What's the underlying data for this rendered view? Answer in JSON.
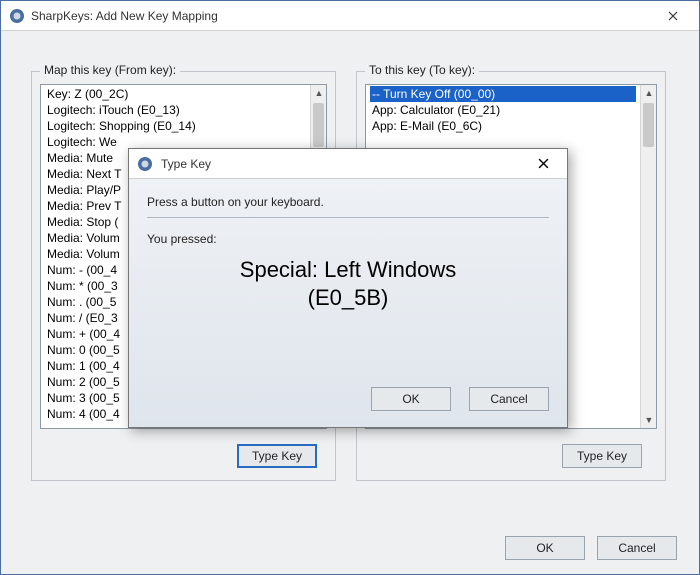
{
  "window": {
    "title": "SharpKeys: Add New Key Mapping"
  },
  "from": {
    "label": "Map this key (From key):",
    "type_key_button": "Type Key",
    "items": [
      "Key: Z (00_2C)",
      "Logitech: iTouch (E0_13)",
      "Logitech: Shopping (E0_14)",
      "Logitech: We",
      "Media: Mute",
      "Media: Next T",
      "Media: Play/P",
      "Media: Prev T",
      "Media: Stop (",
      "Media: Volum",
      "Media: Volum",
      "Num: - (00_4",
      "Num: * (00_3",
      "Num: . (00_5",
      "Num: / (E0_3",
      "Num: + (00_4",
      "Num: 0 (00_5",
      "Num: 1 (00_4",
      "Num: 2 (00_5",
      "Num: 3 (00_5",
      "Num: 4 (00_4"
    ]
  },
  "to": {
    "label": "To this key (To key):",
    "type_key_button": "Type Key",
    "items": [
      "-- Turn Key Off (00_00)",
      "App: Calculator (E0_21)",
      "App: E-Mail (E0_6C)"
    ],
    "selected_index": 0
  },
  "main_buttons": {
    "ok": "OK",
    "cancel": "Cancel"
  },
  "modal": {
    "title": "Type Key",
    "instruction": "Press a button on your keyboard.",
    "pressed_label": "You pressed:",
    "pressed_value_line1": "Special: Left Windows",
    "pressed_value_line2": "(E0_5B)",
    "ok": "OK",
    "cancel": "Cancel"
  }
}
